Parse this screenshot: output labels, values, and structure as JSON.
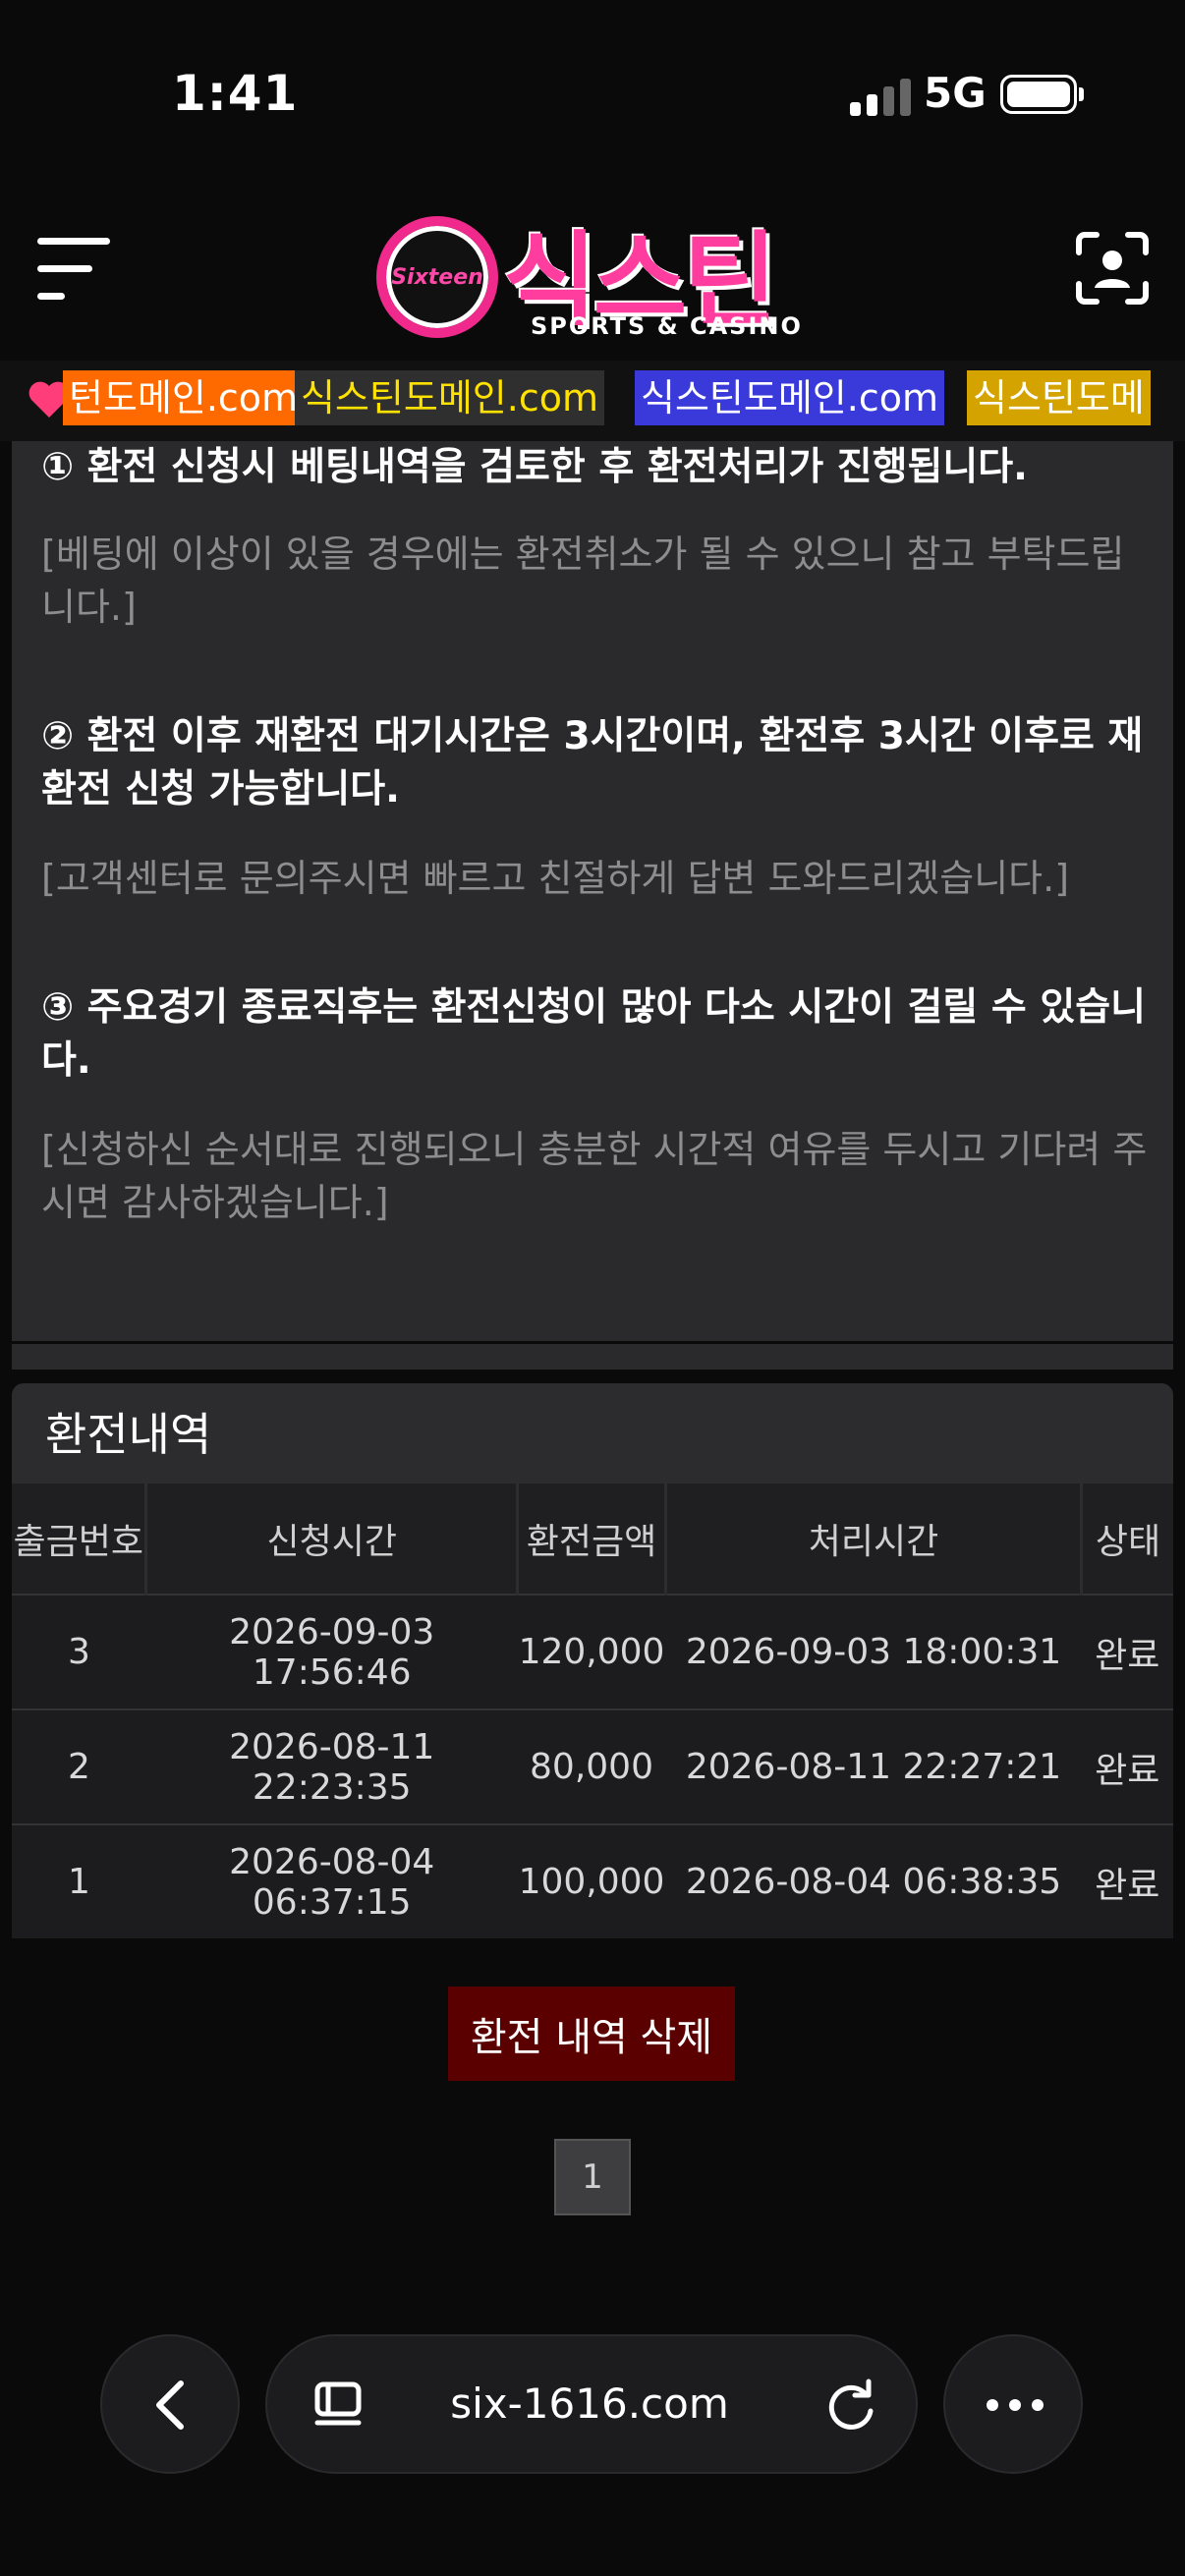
{
  "status_bar": {
    "time": "1:41",
    "network": "5G"
  },
  "header": {
    "logo_badge": "Sixteen",
    "logo_title": "식스틴",
    "logo_subtitle": "SPORTS & CASINO"
  },
  "marquee": [
    {
      "text": "턴도메인.com",
      "bg": "#ff6a00",
      "fg": "#ffffff"
    },
    {
      "text": "식스틴도메인.com",
      "bg": "#2f2f2f",
      "fg": "#ffe200"
    },
    {
      "text": "식스틴도메인.com",
      "bg": "#3a3adb",
      "fg": "#ffffff"
    },
    {
      "text": "식스틴도메",
      "bg": "#d4a300",
      "fg": "#ffffff"
    }
  ],
  "notices": [
    {
      "title": "① 환전 신청시 베팅내역을 검토한 후 환전처리가 진행됩니다.",
      "note": "[베팅에 이상이 있을 경우에는 환전취소가 될 수 있으니 참고 부탁드립니다.]"
    },
    {
      "title": "② 환전 이후 재환전 대기시간은 3시간이며, 환전후 3시간 이후로 재환전 신청 가능합니다.",
      "note": "[고객센터로 문의주시면 빠르고 친절하게 답변 도와드리겠습니다.]"
    },
    {
      "title": "③ 주요경기 종료직후는 환전신청이 많아 다소 시간이 걸릴 수 있습니다.",
      "note": "[신청하신 순서대로 진행되오니 충분한 시간적 여유를 두시고 기다려 주시면 감사하겠습니다.]"
    }
  ],
  "history": {
    "title": "환전내역",
    "columns": [
      "출금번호",
      "신청시간",
      "환전금액",
      "처리시간",
      "상태"
    ],
    "rows": [
      [
        "3",
        "2026-09-03 17:56:46",
        "120,000",
        "2026-09-03 18:00:31",
        "완료"
      ],
      [
        "2",
        "2026-08-11 22:23:35",
        "80,000",
        "2026-08-11 22:27:21",
        "완료"
      ],
      [
        "1",
        "2026-08-04 06:37:15",
        "100,000",
        "2026-08-04 06:38:35",
        "완료"
      ]
    ],
    "delete_label": "환전 내역 삭제",
    "current_page": "1"
  },
  "browser": {
    "url": "six-1616.com"
  },
  "icons": [
    "menu-icon",
    "scan-icon",
    "back-icon",
    "tabs-icon",
    "reload-icon",
    "more-icon",
    "heart-icon"
  ]
}
